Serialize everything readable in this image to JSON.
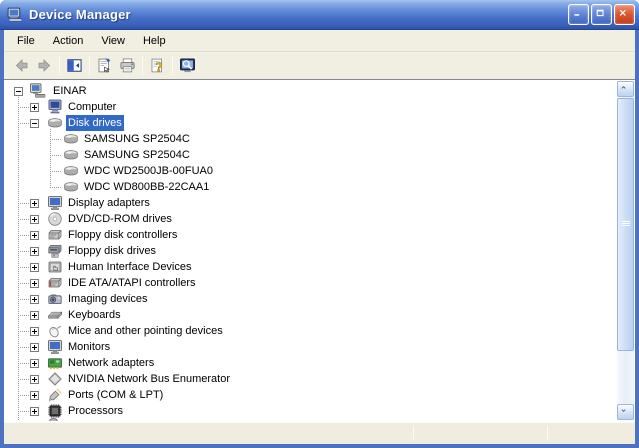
{
  "window": {
    "title": "Device Manager",
    "icon": "device-manager-icon"
  },
  "titlebar_buttons": [
    {
      "name": "minimize-button",
      "icon": "minimize-icon"
    },
    {
      "name": "maximize-button",
      "icon": "maximize-icon"
    },
    {
      "name": "close-button",
      "icon": "close-icon"
    }
  ],
  "menu": {
    "items": [
      {
        "label": "File"
      },
      {
        "label": "Action"
      },
      {
        "label": "View"
      },
      {
        "label": "Help"
      }
    ]
  },
  "toolbar": {
    "items": [
      {
        "type": "button",
        "name": "back-button",
        "icon": "back-arrow-icon",
        "disabled": true
      },
      {
        "type": "button",
        "name": "forward-button",
        "icon": "forward-arrow-icon",
        "disabled": true
      },
      {
        "type": "separator"
      },
      {
        "type": "button",
        "name": "show-hide-console-tree-button",
        "icon": "console-tree-icon",
        "disabled": false
      },
      {
        "type": "separator"
      },
      {
        "type": "button",
        "name": "properties-button",
        "icon": "properties-icon",
        "disabled": false
      },
      {
        "type": "button",
        "name": "print-button",
        "icon": "print-icon",
        "disabled": false
      },
      {
        "type": "separator"
      },
      {
        "type": "button",
        "name": "help-button",
        "icon": "help-icon",
        "disabled": false
      },
      {
        "type": "separator"
      },
      {
        "type": "button",
        "name": "scan-hardware-button",
        "icon": "scan-hardware-icon",
        "disabled": false
      }
    ]
  },
  "tree": {
    "rows": [
      {
        "label": "EINAR",
        "level": 0,
        "expand": "minus",
        "icon": "computer-root-icon",
        "selected": false
      },
      {
        "label": "Computer",
        "level": 1,
        "expand": "plus",
        "icon": "computer-category-icon",
        "selected": false
      },
      {
        "label": "Disk drives",
        "level": 1,
        "expand": "minus",
        "icon": "disk-drive-icon",
        "selected": true
      },
      {
        "label": "SAMSUNG SP2504C",
        "level": 2,
        "expand": null,
        "icon": "disk-drive-icon",
        "selected": false
      },
      {
        "label": "SAMSUNG SP2504C",
        "level": 2,
        "expand": null,
        "icon": "disk-drive-icon",
        "selected": false
      },
      {
        "label": "WDC WD2500JB-00FUA0",
        "level": 2,
        "expand": null,
        "icon": "disk-drive-icon",
        "selected": false
      },
      {
        "label": "WDC WD800BB-22CAA1",
        "level": 2,
        "expand": null,
        "icon": "disk-drive-icon",
        "selected": false
      },
      {
        "label": "Display adapters",
        "level": 1,
        "expand": "plus",
        "icon": "display-adapter-icon",
        "selected": false
      },
      {
        "label": "DVD/CD-ROM drives",
        "level": 1,
        "expand": "plus",
        "icon": "dvd-drive-icon",
        "selected": false
      },
      {
        "label": "Floppy disk controllers",
        "level": 1,
        "expand": "plus",
        "icon": "floppy-controller-icon",
        "selected": false
      },
      {
        "label": "Floppy disk drives",
        "level": 1,
        "expand": "plus",
        "icon": "floppy-drive-icon",
        "selected": false
      },
      {
        "label": "Human Interface Devices",
        "level": 1,
        "expand": "plus",
        "icon": "hid-icon",
        "selected": false
      },
      {
        "label": "IDE ATA/ATAPI controllers",
        "level": 1,
        "expand": "plus",
        "icon": "ide-controller-icon",
        "selected": false
      },
      {
        "label": "Imaging devices",
        "level": 1,
        "expand": "plus",
        "icon": "imaging-device-icon",
        "selected": false
      },
      {
        "label": "Keyboards",
        "level": 1,
        "expand": "plus",
        "icon": "keyboard-icon",
        "selected": false
      },
      {
        "label": "Mice and other pointing devices",
        "level": 1,
        "expand": "plus",
        "icon": "mouse-icon",
        "selected": false
      },
      {
        "label": "Monitors",
        "level": 1,
        "expand": "plus",
        "icon": "monitor-icon",
        "selected": false
      },
      {
        "label": "Network adapters",
        "level": 1,
        "expand": "plus",
        "icon": "network-adapter-icon",
        "selected": false
      },
      {
        "label": "NVIDIA Network Bus Enumerator",
        "level": 1,
        "expand": "plus",
        "icon": "nvidia-bus-icon",
        "selected": false
      },
      {
        "label": "Ports (COM & LPT)",
        "level": 1,
        "expand": "plus",
        "icon": "ports-icon",
        "selected": false
      },
      {
        "label": "Processors",
        "level": 1,
        "expand": "plus",
        "icon": "processor-icon",
        "selected": false
      }
    ],
    "partial_row_visible": true
  },
  "scrollbar": {
    "up_icon": "chevron-up-icon",
    "down_icon": "chevron-down-icon"
  },
  "colors": {
    "selection": "#316AC5",
    "titlebar_top": "#A6C4EE",
    "titlebar_bottom": "#2C53A8",
    "window_border": "#4E71C0",
    "chrome_background": "#F1EEE2",
    "tree_background": "#FFFFFF",
    "close_button": "#DA5A35"
  }
}
